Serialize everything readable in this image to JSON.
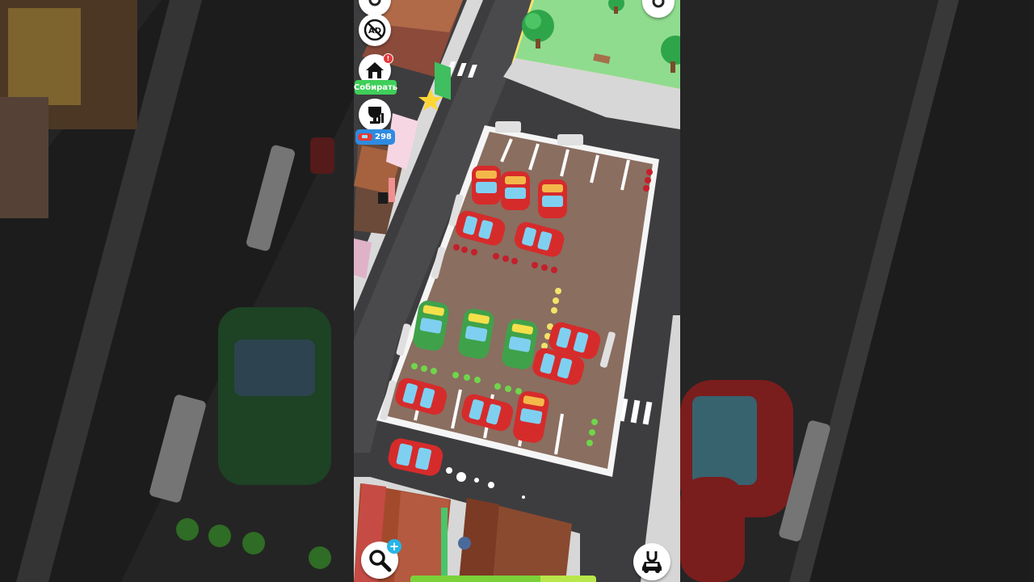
{
  "hud": {
    "collect_label": "Собирать",
    "coin_count": "298",
    "house_badge": "!",
    "plus_label": "+",
    "bottom_progress": 0.7
  },
  "icons": {
    "no_ads": "no-ads-icon",
    "house": "house-icon",
    "trophy": "trophy-icon",
    "magnifier": "magnifier-icon",
    "car_magnet": "car-magnet-icon"
  },
  "colors": {
    "collect_button": "#3fcf5a",
    "counter_badge": "#2f8be0",
    "car_red": "#e53935",
    "car_green": "#3fa24a",
    "parking_lot": "#8a6e60",
    "road": "#3d3d3f",
    "park_grass": "#8fdc8f",
    "plus_badge": "#27b5e8"
  }
}
